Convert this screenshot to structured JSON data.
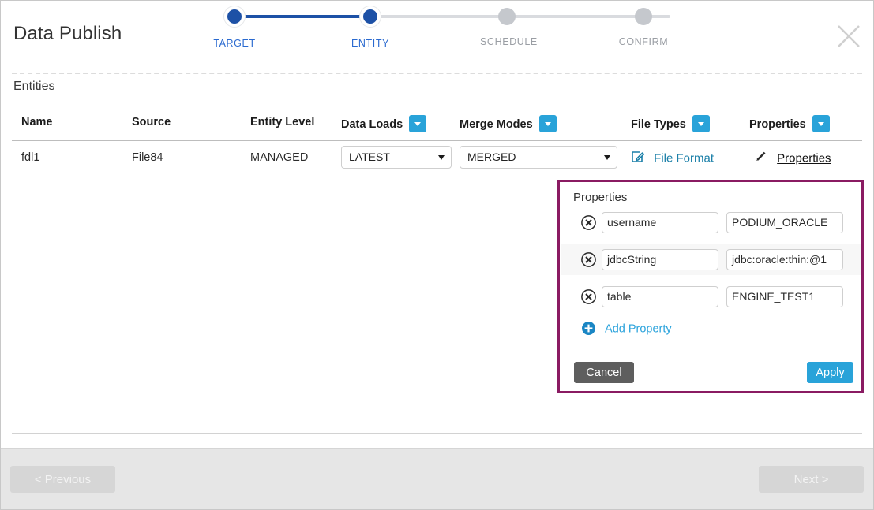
{
  "header": {
    "title": "Data Publish",
    "close_icon": "close-icon",
    "steps": [
      {
        "label": "TARGET",
        "state": "done"
      },
      {
        "label": "ENTITY",
        "state": "active"
      },
      {
        "label": "SCHEDULE",
        "state": "todo"
      },
      {
        "label": "CONFIRM",
        "state": "todo"
      }
    ]
  },
  "entities": {
    "section_title": "Entities",
    "columns": [
      {
        "label": "Name",
        "has_dropdown": false
      },
      {
        "label": "Source",
        "has_dropdown": false
      },
      {
        "label": "Entity Level",
        "has_dropdown": false
      },
      {
        "label": "Data Loads",
        "has_dropdown": true
      },
      {
        "label": "Merge Modes",
        "has_dropdown": true
      },
      {
        "label": "File Types",
        "has_dropdown": true
      },
      {
        "label": "Properties",
        "has_dropdown": true
      }
    ],
    "rows": [
      {
        "name": "fdl1",
        "source": "File84",
        "entity_level": "MANAGED",
        "data_load": "LATEST",
        "merge_mode": "MERGED",
        "file_type_label": "File Format",
        "properties_label": "Properties"
      }
    ]
  },
  "properties_popup": {
    "title": "Properties",
    "rows": [
      {
        "key": "username",
        "value": "PODIUM_ORACLE"
      },
      {
        "key": "jdbcString",
        "value": "jdbc:oracle:thin:@1"
      },
      {
        "key": "table",
        "value": "ENGINE_TEST1"
      }
    ],
    "add_property_label": "Add Property",
    "cancel_label": "Cancel",
    "apply_label": "Apply",
    "border_color": "#8a1b62"
  },
  "footer": {
    "previous_label": "< Previous",
    "next_label": "Next >"
  },
  "colors": {
    "accent_blue": "#29a3d9",
    "step_blue": "#1d51a6",
    "link_blue": "#1a7fa8",
    "popup_border": "#8a1b62"
  }
}
